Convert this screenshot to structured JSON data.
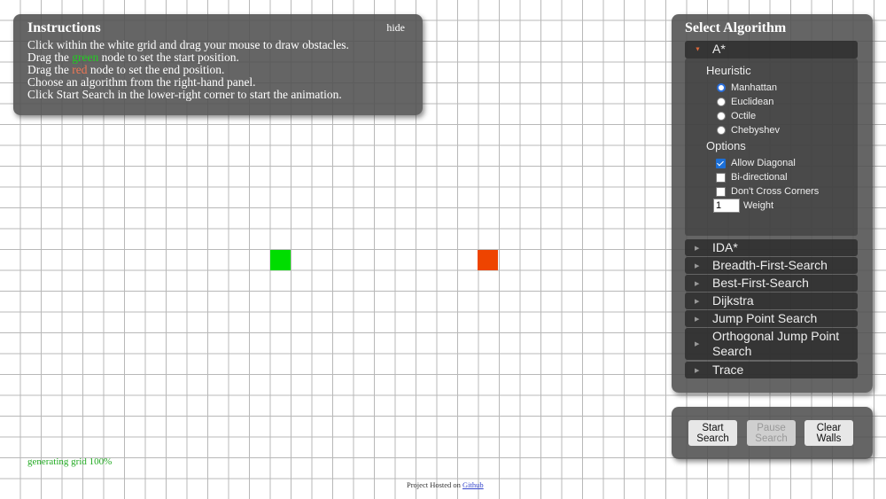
{
  "instructions": {
    "title": "Instructions",
    "hide_label": "hide",
    "line1": "Click within the white grid and drag your mouse to draw obstacles.",
    "line2_pre": "Drag the ",
    "line2_word": "green",
    "line2_post": " node to set the start position.",
    "line3_pre": "Drag the ",
    "line3_word": "red",
    "line3_post": " node to set the end position.",
    "line4": "Choose an algorithm from the right-hand panel.",
    "line5": "Click Start Search in the lower-right corner to start the animation."
  },
  "algorithm_panel": {
    "title": "Select Algorithm",
    "selected": "A*",
    "astar": {
      "heuristic_title": "Heuristic",
      "heuristics": [
        "Manhattan",
        "Euclidean",
        "Octile",
        "Chebyshev"
      ],
      "selected_heuristic": "Manhattan",
      "options_title": "Options",
      "options": [
        {
          "label": "Allow Diagonal",
          "checked": true
        },
        {
          "label": "Bi-directional",
          "checked": false
        },
        {
          "label": "Don't Cross Corners",
          "checked": false
        }
      ],
      "weight_value": "1",
      "weight_label": "Weight"
    },
    "algorithms": [
      "A*",
      "IDA*",
      "Breadth-First-Search",
      "Best-First-Search",
      "Dijkstra",
      "Jump Point Search",
      "Orthogonal Jump Point Search",
      "Trace"
    ]
  },
  "controls": {
    "start_label": "Start Search",
    "pause_label": "Pause Search",
    "clear_label": "Clear Walls",
    "pause_disabled": true
  },
  "grid": {
    "start_color": "#00dd00",
    "end_color": "#ee4400"
  },
  "status": "generating grid 100%",
  "footer": {
    "text": "Project Hosted on ",
    "link": "Github"
  }
}
